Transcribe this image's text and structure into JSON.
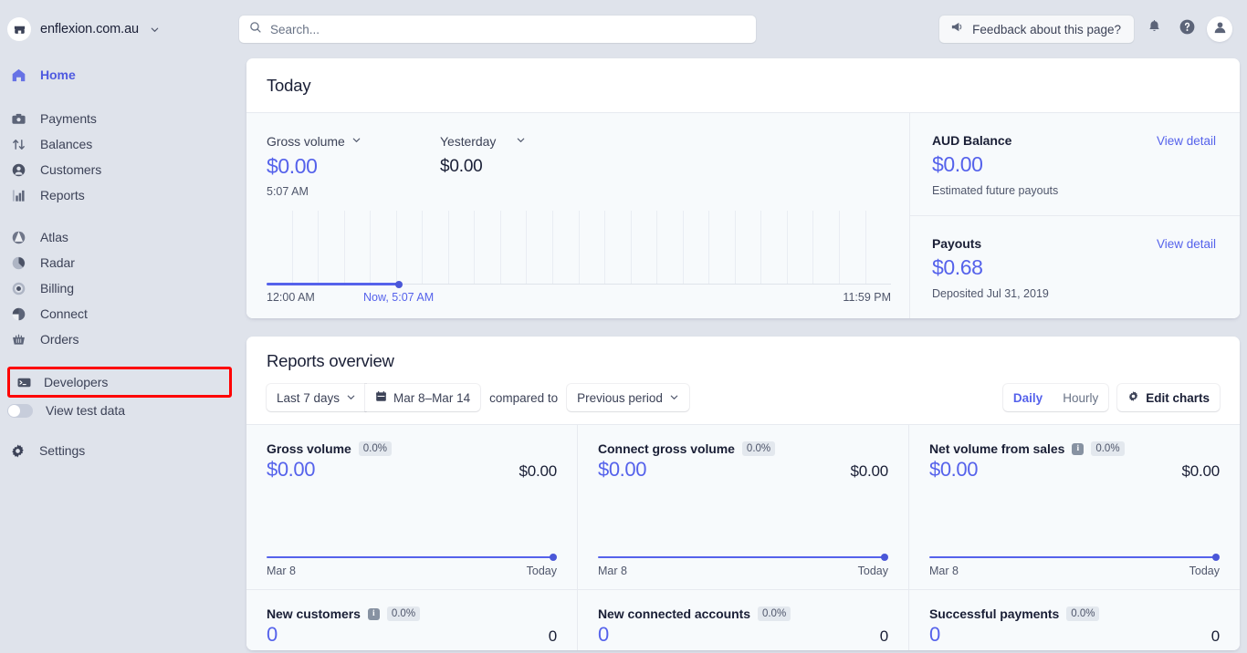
{
  "sidebar": {
    "account": {
      "name": "enflexion.com.au",
      "logo_icon": "store-icon",
      "caret_icon": "chevron-down-icon"
    },
    "primary": [
      {
        "label": "Home",
        "icon": "home-icon",
        "active": true
      }
    ],
    "group1": [
      {
        "label": "Payments",
        "icon": "payments-icon"
      },
      {
        "label": "Balances",
        "icon": "balances-icon"
      },
      {
        "label": "Customers",
        "icon": "customers-icon"
      },
      {
        "label": "Reports",
        "icon": "reports-icon"
      }
    ],
    "group2": [
      {
        "label": "Atlas",
        "icon": "atlas-icon"
      },
      {
        "label": "Radar",
        "icon": "radar-icon"
      },
      {
        "label": "Billing",
        "icon": "billing-icon"
      },
      {
        "label": "Connect",
        "icon": "connect-icon"
      },
      {
        "label": "Orders",
        "icon": "orders-icon"
      }
    ],
    "developers": {
      "label": "Developers",
      "icon": "terminal-icon",
      "highlight_color": "#ff0000"
    },
    "test_data": {
      "label": "View test data",
      "toggle_state": "off"
    },
    "settings": {
      "label": "Settings",
      "icon": "gear-icon"
    }
  },
  "topbar": {
    "search": {
      "placeholder": "Search...",
      "value": "",
      "icon": "search-icon"
    },
    "feedback": {
      "label": "Feedback about this page?",
      "icon": "megaphone-icon"
    },
    "notifications_icon": "bell-icon",
    "help_icon": "question-circle-icon",
    "avatar_icon": "user-avatar-icon"
  },
  "today": {
    "title": "Today",
    "gross_volume": {
      "selector_label": "Gross volume",
      "amount": "$0.00",
      "time": "5:07 AM"
    },
    "yesterday": {
      "selector_label": "Yesterday",
      "amount": "$0.00"
    },
    "chart": {
      "axis_left": "12:00 AM",
      "axis_now": "Now, 5:07 AM",
      "axis_right": "11:59 PM"
    },
    "balance": {
      "title": "AUD Balance",
      "link": "View detail",
      "amount": "$0.00",
      "sub": "Estimated future payouts"
    },
    "payouts": {
      "title": "Payouts",
      "link": "View detail",
      "amount": "$0.68",
      "sub": "Deposited Jul 31, 2019"
    }
  },
  "reports": {
    "title": "Reports overview",
    "range_select": "Last 7 days",
    "date_range": "Mar 8–Mar 14",
    "calendar_icon": "calendar-icon",
    "compared_to_label": "compared to",
    "compare_select": "Previous period",
    "granularity": {
      "daily": "Daily",
      "hourly": "Hourly",
      "selected": "Daily"
    },
    "edit_charts": {
      "label": "Edit charts",
      "icon": "gear-icon"
    },
    "metrics_row1": [
      {
        "name": "Gross volume",
        "has_info": false,
        "badge": "0.0%",
        "primary": "$0.00",
        "secondary": "$0.00",
        "axis_left": "Mar 8",
        "axis_right": "Today"
      },
      {
        "name": "Connect gross volume",
        "has_info": false,
        "badge": "0.0%",
        "primary": "$0.00",
        "secondary": "$0.00",
        "axis_left": "Mar 8",
        "axis_right": "Today"
      },
      {
        "name": "Net volume from sales",
        "has_info": true,
        "badge": "0.0%",
        "primary": "$0.00",
        "secondary": "$0.00",
        "axis_left": "Mar 8",
        "axis_right": "Today"
      }
    ],
    "metrics_row2": [
      {
        "name": "New customers",
        "has_info": true,
        "badge": "0.0%",
        "primary": "0",
        "secondary": "0"
      },
      {
        "name": "New connected accounts",
        "has_info": false,
        "badge": "0.0%",
        "primary": "0",
        "secondary": "0"
      },
      {
        "name": "Successful payments",
        "has_info": false,
        "badge": "0.0%",
        "primary": "0",
        "secondary": "0"
      }
    ]
  },
  "chart_data": {
    "type": "line",
    "title": "Today gross volume",
    "x": [
      "12:00 AM",
      "Now, 5:07 AM",
      "11:59 PM"
    ],
    "values": [
      0,
      0,
      0
    ],
    "progress_fraction": 0.212,
    "gridline_count": 24,
    "ylabel": "",
    "xlabel": ""
  }
}
